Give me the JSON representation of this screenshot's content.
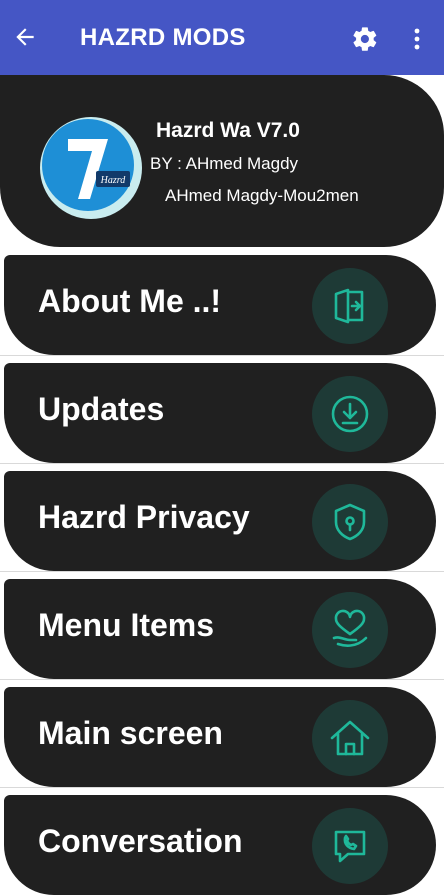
{
  "app_bar": {
    "title": "HAZRD MODS",
    "back_icon": "arrow-left-icon",
    "settings_icon": "gear-icon",
    "more_icon": "more-vertical-icon",
    "color": "#4556c5"
  },
  "header": {
    "logo_text": "Hazrd",
    "title": "Hazrd Wa V7.0",
    "by": "BY : AHmed Magdy",
    "author": "AHmed Magdy-Mou2men"
  },
  "menu": [
    {
      "label": "About Me ..!",
      "icon": "login-door-icon"
    },
    {
      "label": "Updates",
      "icon": "download-icon"
    },
    {
      "label": "Hazrd Privacy",
      "icon": "shield-lock-icon"
    },
    {
      "label": "Menu Items",
      "icon": "heart-hand-icon"
    },
    {
      "label": "Main screen",
      "icon": "home-icon"
    },
    {
      "label": "Conversation",
      "icon": "chat-phone-icon"
    }
  ],
  "colors": {
    "card": "#202020",
    "icon_circle": "#1e3a36",
    "icon_stroke": "#1fb89a"
  }
}
